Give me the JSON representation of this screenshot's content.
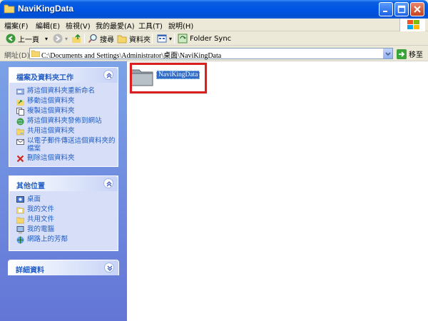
{
  "window": {
    "title": "NaviKingData"
  },
  "menu": [
    "檔案(F)",
    "編輯(E)",
    "檢視(V)",
    "我的最愛(A)",
    "工具(T)",
    "說明(H)"
  ],
  "toolbar": {
    "back": "上一頁",
    "search": "搜尋",
    "folders": "資料夾",
    "folder_sync": "Folder Sync"
  },
  "address": {
    "label": "網址(D)",
    "path": "C:\\Documents and Settings\\Administrator\\桌面\\NaviKingData",
    "go": "移至"
  },
  "panels": {
    "tasks": {
      "title": "檔案及資料夾工作",
      "items": [
        "將這個資料夾重新命名",
        "移動這個資料夾",
        "複製這個資料夾",
        "將這個資料夾發佈到網站",
        "共用這個資料夾",
        "以電子郵件傳送這個資料夾的檔案",
        "刪除這個資料夾"
      ]
    },
    "other": {
      "title": "其他位置",
      "items": [
        "桌面",
        "我的文件",
        "共用文件",
        "我的電腦",
        "網路上的芳鄰"
      ]
    },
    "details": {
      "title": "詳細資料"
    }
  },
  "content": {
    "folder_name": "NaviKingData"
  },
  "colors": {
    "titlebar": "#0055e5",
    "taskpane": "#6375d6",
    "highlight_box": "#d91f1f",
    "selection": "#316ac5"
  }
}
